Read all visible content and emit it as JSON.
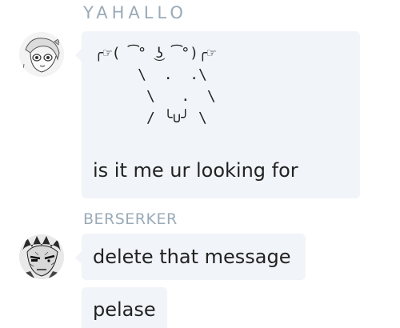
{
  "messages": [
    {
      "sender": "YAHALLO",
      "avatar_icon": "anime-girl-sketch-avatar-icon",
      "ascii_art": "╭☞( ͡° ͜ʖ ͡°)╭☞\n     \\  .  .\\\n      \\   .  \\\n      / ╰∪╯ \\",
      "text": "is it me ur looking for"
    },
    {
      "sender": "BERSERKER",
      "avatar_icon": "berserker-manga-avatar-icon",
      "lines": [
        "delete that message",
        "pelase"
      ]
    }
  ],
  "colors": {
    "sender": "#9aaab7",
    "bubble": "#f1f4f8",
    "text": "#222222"
  }
}
